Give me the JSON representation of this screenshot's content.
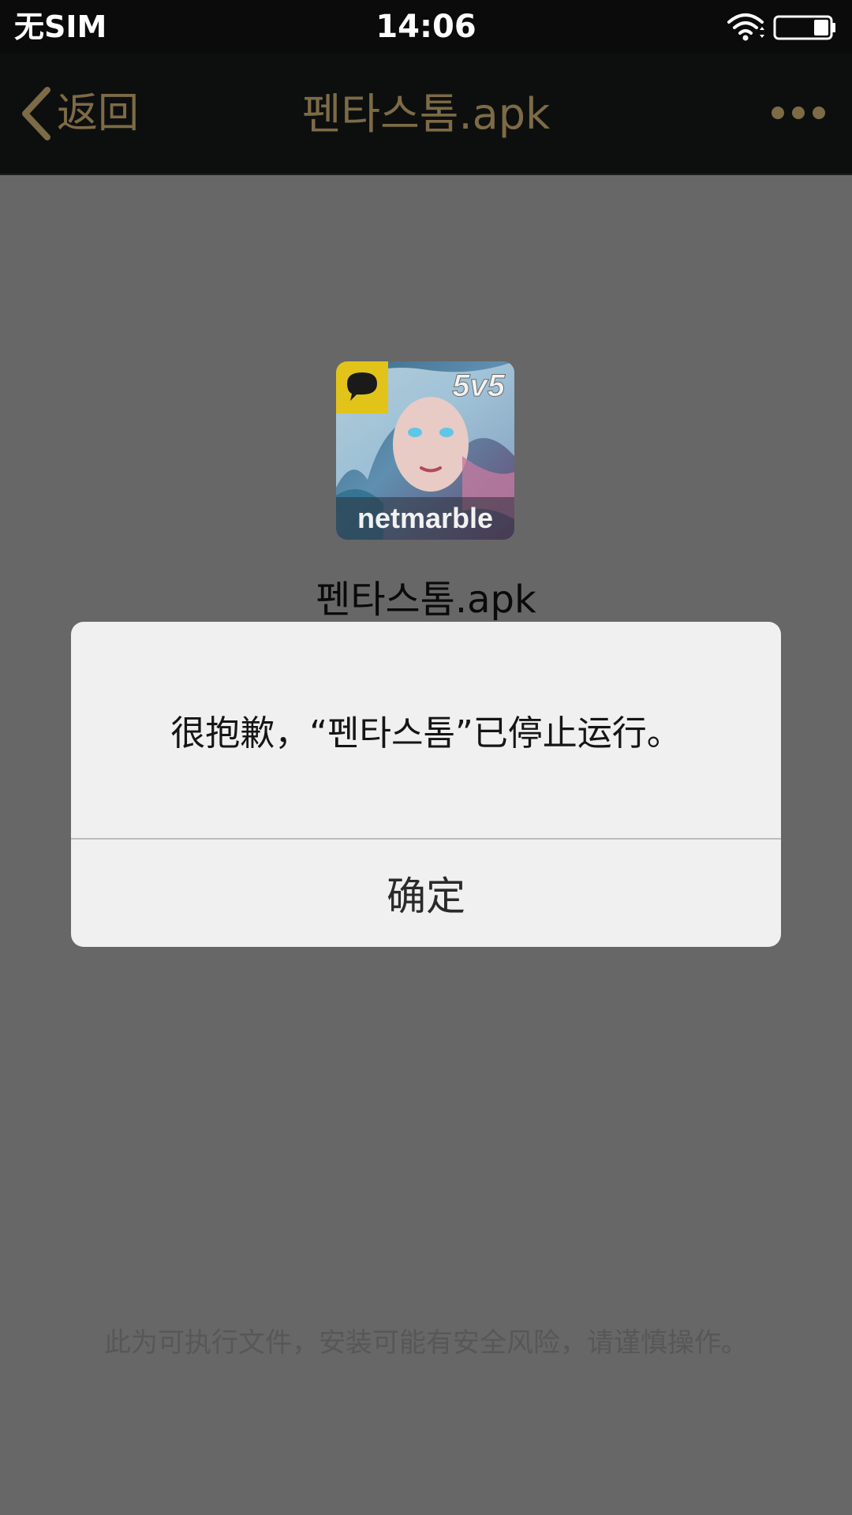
{
  "status_bar": {
    "carrier": "无SIM",
    "time": "14:06",
    "wifi_icon": "wifi-icon",
    "battery_icon": "battery-icon"
  },
  "nav": {
    "back_label": "返回",
    "title": "펜타스톰.apk",
    "back_icon": "chevron-left-icon",
    "more_icon": "more-horizontal-icon",
    "accent_color": "#7d6b46"
  },
  "content": {
    "app_icon": {
      "badge_text": "5v5",
      "brand_text": "netmarble",
      "corner_icon": "chat-bubble-icon"
    },
    "file_name": "펜타스톰.apk",
    "security_note": "此为可执行文件，安装可能有安全风险，请谨慎操作。"
  },
  "dialog": {
    "message": "很抱歉，“펜타스톰”已停止运行。",
    "confirm_label": "确定"
  }
}
